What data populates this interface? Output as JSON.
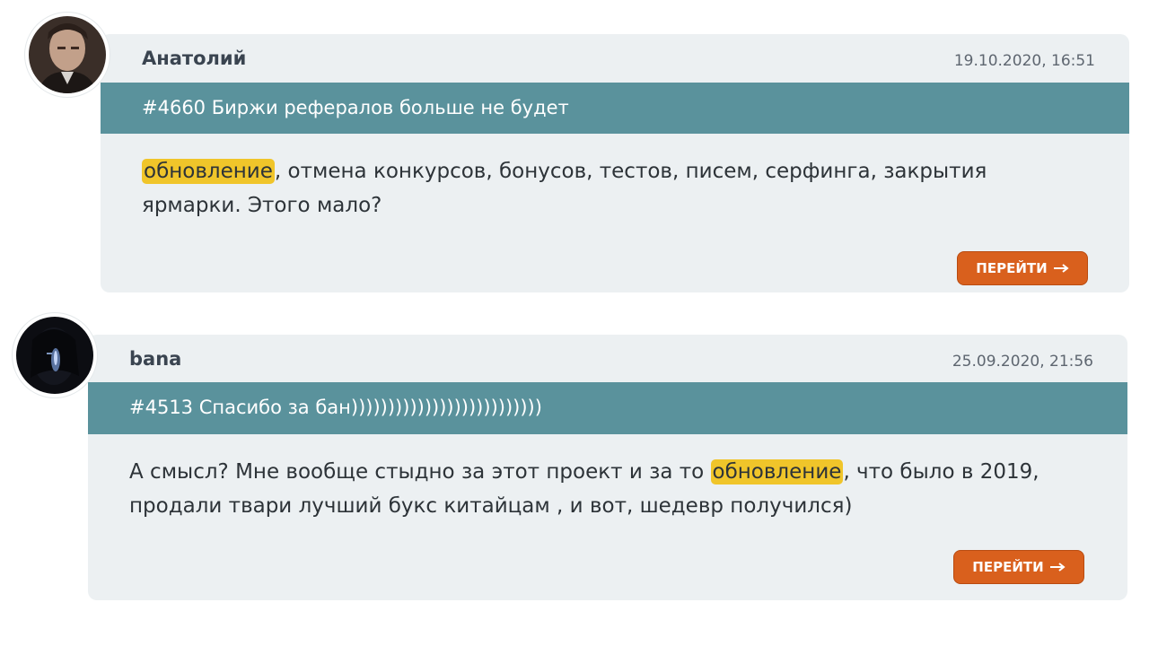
{
  "posts": [
    {
      "author": "Анатолий",
      "date": "19.10.2020, 16:51",
      "topic": "#4660 Биржи рефералов больше не будет",
      "body_highlight": "обновление",
      "body_rest": ", отмена конкурсов, бонусов, тестов, писем, серфинга, закрытия ярмарки. Этого мало?",
      "button_label": "ПЕРЕЙТИ",
      "button_icon": "arrow-right-icon"
    },
    {
      "author": "bana",
      "date": "25.09.2020, 21:56",
      "topic": "#4513 Спасибо за бан))))))))))))))))))))))))))",
      "body_before": "А смысл? Мне вообще стыдно за этот проект и за то ",
      "body_highlight": "обновление",
      "body_after": ", что было в 2019, продали твари лучший букс китайцам , и вот, шедевр получился)",
      "button_label": "ПЕРЕЙТИ",
      "button_icon": "arrow-right-icon"
    }
  ],
  "colors": {
    "card_bg": "#ecf0f2",
    "topic_bar": "#5a929c",
    "highlight": "#f0c52a",
    "button": "#d9601d"
  }
}
